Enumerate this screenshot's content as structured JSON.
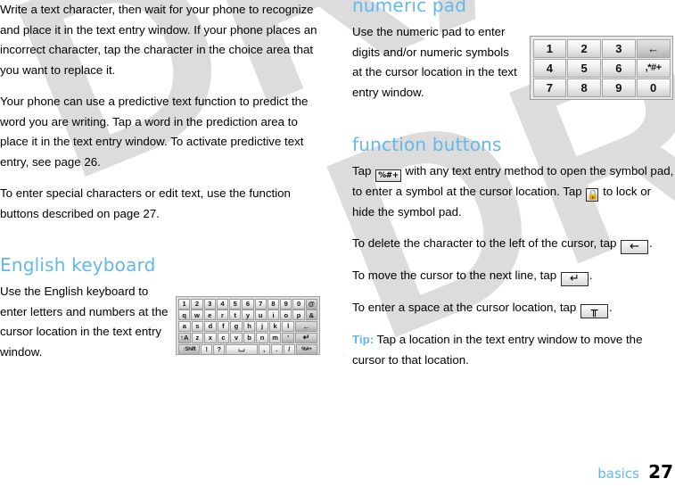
{
  "document": {
    "type": "user-guide-page",
    "watermark": "DRAFT",
    "accent_color": "#63b8e8",
    "background_color": "#ffffff",
    "watermark_color": "#dcdcdc"
  },
  "left_column": {
    "paragraphs": [
      "Write a text character, then wait for your phone to recognize and place it in the text entry window. If your phone places an incorrect character, tap the character in the choice area that you want to replace it.",
      "Your phone can use a predictive text function to predict the word you are writing. Tap a word in the prediction area to place it in the text entry window. To activate predictive text entry, see page 26.",
      "To enter special characters or edit text, use the function buttons described on page 27."
    ],
    "section": {
      "heading": "English keyboard",
      "paragraph": "Use the English keyboard to enter letters and numbers at the cursor location in the text entry window."
    }
  },
  "right_column": {
    "numeric_pad_section": {
      "heading": "numeric pad",
      "paragraph": "Use the numeric pad to enter digits and/or numeric symbols at the cursor location in the text entry window."
    },
    "function_buttons_section": {
      "heading": "function buttons",
      "para1_a": "Tap",
      "para1_b": "with any text entry method to open the symbol pad, to enter a symbol at the cursor location. Tap",
      "para1_c": "to lock or hide the symbol pad.",
      "para2_a": "To delete the character to the left of the cursor, tap",
      "para2_b": ".",
      "para3_a": "To move the cursor to the next line, tap",
      "para3_b": ".",
      "para4_a": "To enter a space at the cursor location, tap",
      "para4_b": ".",
      "tip_label": "Tip:",
      "tip_text": "Tap a location in the text entry window to move the cursor to that location."
    },
    "inline_icons": {
      "symbol_pad": "%#+",
      "lock": "⬚",
      "backspace": "←",
      "return": "↵",
      "space": "⌴"
    }
  },
  "numeric_pad_graphic": {
    "rows": [
      [
        {
          "label": "1",
          "style": "light"
        },
        {
          "label": "2",
          "style": "light"
        },
        {
          "label": "3",
          "style": "light"
        },
        {
          "label": "←",
          "style": "dark"
        }
      ],
      [
        {
          "label": "4",
          "style": "light"
        },
        {
          "label": "5",
          "style": "light"
        },
        {
          "label": "6",
          "style": "light"
        },
        {
          "label": ",*#+",
          "style": "sym"
        }
      ],
      [
        {
          "label": "7",
          "style": "light"
        },
        {
          "label": "8",
          "style": "light"
        },
        {
          "label": "9",
          "style": "light"
        },
        {
          "label": "0",
          "style": "light"
        }
      ]
    ]
  },
  "english_keyboard_graphic": {
    "rows": [
      [
        {
          "label": "1"
        },
        {
          "label": "2"
        },
        {
          "label": "3"
        },
        {
          "label": "4"
        },
        {
          "label": "5"
        },
        {
          "label": "6"
        },
        {
          "label": "7"
        },
        {
          "label": "8"
        },
        {
          "label": "9"
        },
        {
          "label": "0"
        },
        {
          "label": "@",
          "style": "dark"
        }
      ],
      [
        {
          "label": "q"
        },
        {
          "label": "w"
        },
        {
          "label": "e"
        },
        {
          "label": "r"
        },
        {
          "label": "t"
        },
        {
          "label": "y"
        },
        {
          "label": "u"
        },
        {
          "label": "i"
        },
        {
          "label": "o"
        },
        {
          "label": "p"
        },
        {
          "label": "&",
          "style": "dark"
        }
      ],
      [
        {
          "label": "a"
        },
        {
          "label": "s"
        },
        {
          "label": "d"
        },
        {
          "label": "f"
        },
        {
          "label": "g"
        },
        {
          "label": "h"
        },
        {
          "label": "j"
        },
        {
          "label": "k"
        },
        {
          "label": "l"
        },
        {
          "label": "←",
          "style": "dark",
          "width": 2
        }
      ],
      [
        {
          "label": "↑A",
          "style": "dark"
        },
        {
          "label": "z"
        },
        {
          "label": "x"
        },
        {
          "label": "c"
        },
        {
          "label": "v"
        },
        {
          "label": "b"
        },
        {
          "label": "n"
        },
        {
          "label": "m"
        },
        {
          "label": "'",
          "style": "dark"
        },
        {
          "label": "↵",
          "style": "dark",
          "width": 2
        }
      ],
      [
        {
          "label": "↑Shift",
          "style": "dark",
          "width": 2
        },
        {
          "label": "!"
        },
        {
          "label": "?"
        },
        {
          "label": "⌴",
          "style": "light",
          "width": 3
        },
        {
          "label": ","
        },
        {
          "label": "."
        },
        {
          "label": "/"
        },
        {
          "label": "%#+",
          "style": "dark",
          "width": 2
        }
      ]
    ]
  },
  "footer": {
    "chapter": "basics",
    "page_number": "27"
  }
}
